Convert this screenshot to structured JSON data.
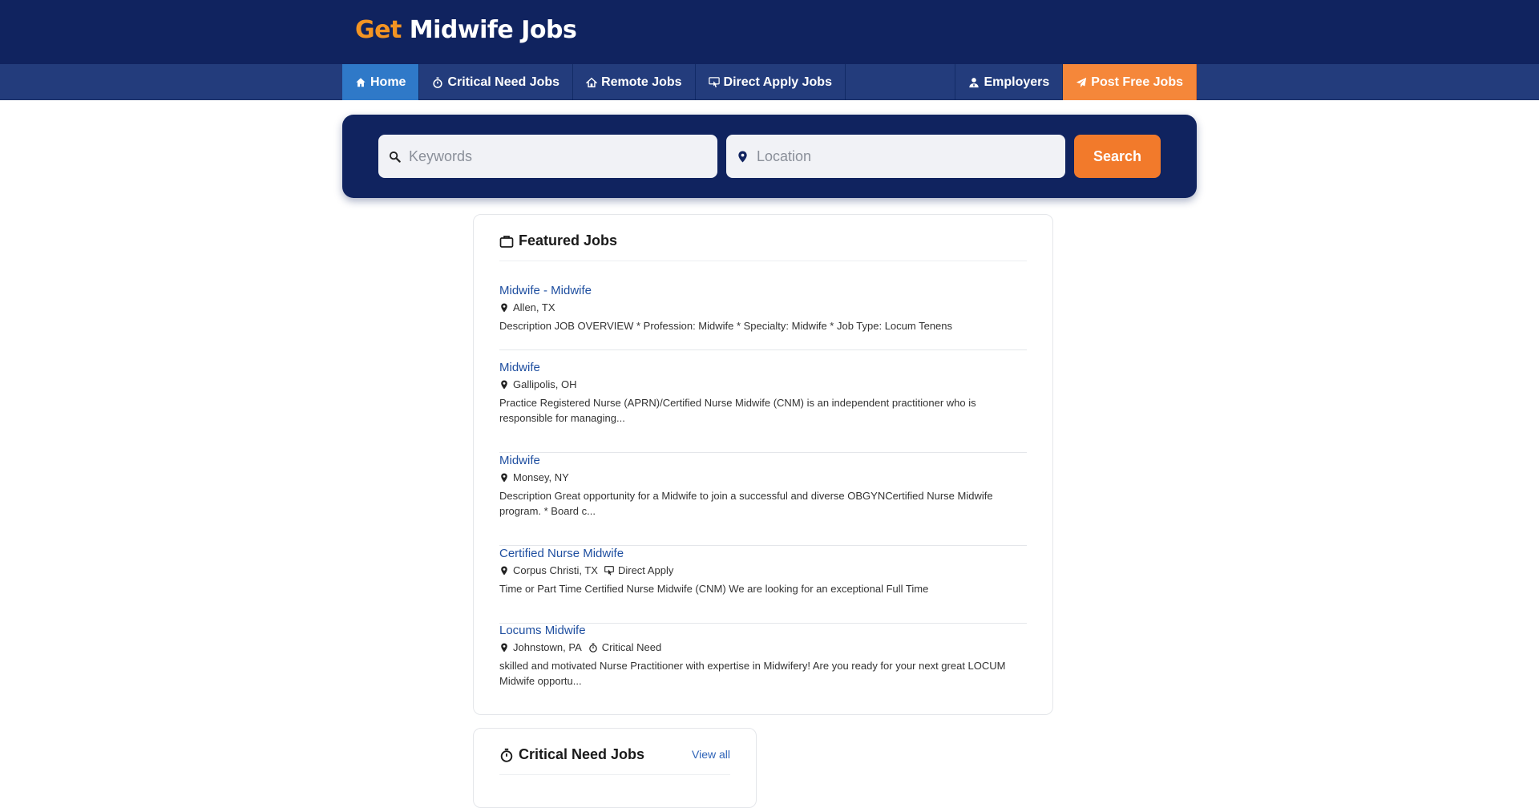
{
  "brand": {
    "part1": "Get",
    "part2": "Midwife Jobs",
    "accent": "#f39423",
    "navy": "#10235f"
  },
  "nav": {
    "left": [
      {
        "label": "Home",
        "icon": "home-icon"
      },
      {
        "label": "Critical Need Jobs",
        "icon": "stopwatch-icon"
      },
      {
        "label": "Remote Jobs",
        "icon": "house-icon"
      },
      {
        "label": "Direct Apply Jobs",
        "icon": "hand-pointer-icon"
      }
    ],
    "right": [
      {
        "label": "Employers",
        "icon": "user-tie-icon"
      },
      {
        "label": "Post Free Jobs",
        "icon": "paper-plane-icon"
      }
    ]
  },
  "search": {
    "keywords_placeholder": "Keywords",
    "location_placeholder": "Location",
    "button_label": "Search"
  },
  "featured": {
    "title": "Featured Jobs",
    "jobs": [
      {
        "title": "Midwife - Midwife",
        "location": "Allen, TX",
        "tag": "",
        "desc": "Description JOB OVERVIEW * Profession: Midwife * Specialty: Midwife * Job Type: Locum Tenens"
      },
      {
        "title": "Midwife",
        "location": "Gallipolis, OH",
        "tag": "",
        "desc": "Practice Registered Nurse (APRN)/Certified Nurse Midwife (CNM) is an independent practitioner who is responsible for managing..."
      },
      {
        "title": "Midwife",
        "location": "Monsey, NY",
        "tag": "",
        "desc": "Description Great opportunity for a Midwife to join a successful and diverse OBGYNCertified Nurse Midwife program. * Board c..."
      },
      {
        "title": "Certified Nurse Midwife",
        "location": "Corpus Christi, TX",
        "tag": "Direct Apply",
        "desc": "Time or Part Time Certified Nurse Midwife (CNM) We are looking for an exceptional Full Time"
      },
      {
        "title": "Locums Midwife",
        "location": "Johnstown, PA",
        "tag": "Critical Need",
        "desc": "skilled and motivated Nurse Practitioner with expertise in Midwifery! Are you ready for your next great LOCUM Midwife opportu..."
      }
    ]
  },
  "critical": {
    "title": "Critical Need Jobs",
    "view_all": "View all"
  }
}
